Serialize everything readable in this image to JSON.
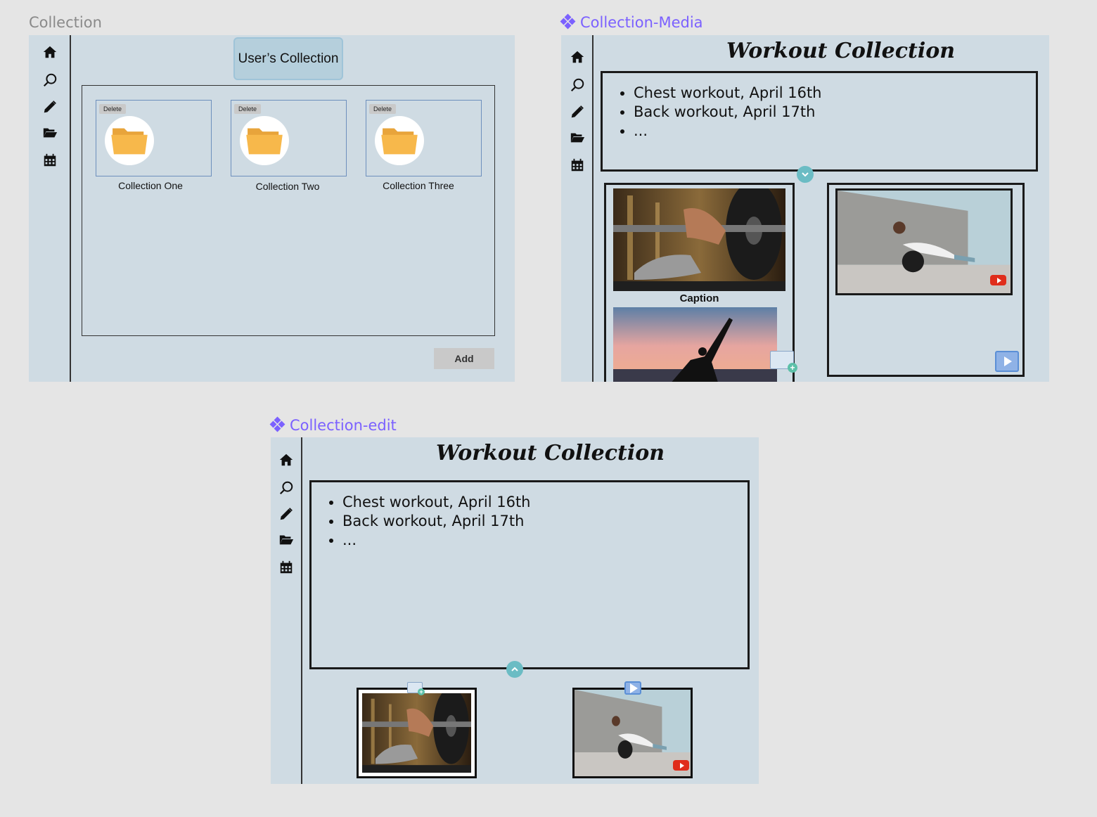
{
  "frames": {
    "collection": {
      "label": "Collection"
    },
    "collection_media": {
      "label": "Collection-Media"
    },
    "collection_edit": {
      "label": "Collection-edit"
    }
  },
  "sidebar": {
    "icons": [
      "home-icon",
      "search-icon",
      "pencil-icon",
      "folder-open-icon",
      "calendar-icon"
    ]
  },
  "collection": {
    "header_button": "User’s Collection",
    "cards": [
      {
        "delete_label": "Delete",
        "name": "Collection One"
      },
      {
        "delete_label": "Delete",
        "name": "Collection Two"
      },
      {
        "delete_label": "Delete",
        "name": "Collection Three"
      }
    ],
    "add_label": "Add"
  },
  "workout": {
    "title": "Workout Collection",
    "notes": [
      "Chest workout, April 16th",
      "Back workout, April 17th",
      "..."
    ],
    "caption": "Caption"
  },
  "colors": {
    "frame_bg": "#cfdbe3",
    "accent_component": "#7b61ff",
    "toggle": "#6bbcc4",
    "folder": "#f7b84b",
    "youtube_red": "#e02d1b"
  }
}
